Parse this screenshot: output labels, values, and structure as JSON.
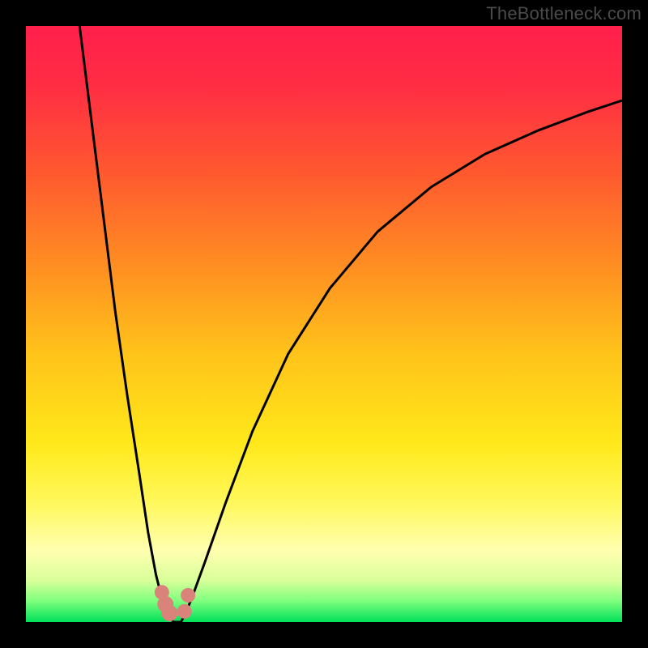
{
  "watermark": "TheBottleneck.com",
  "chart_data": {
    "type": "line",
    "title": "",
    "xlabel": "",
    "ylabel": "",
    "xlim": [
      0,
      1
    ],
    "ylim": [
      0,
      100
    ],
    "gradient_stops": [
      {
        "offset": 0.0,
        "color": "#ff1f4b"
      },
      {
        "offset": 0.1,
        "color": "#ff2d44"
      },
      {
        "offset": 0.25,
        "color": "#ff5a2f"
      },
      {
        "offset": 0.4,
        "color": "#ff8d22"
      },
      {
        "offset": 0.55,
        "color": "#ffc31a"
      },
      {
        "offset": 0.7,
        "color": "#ffe81a"
      },
      {
        "offset": 0.8,
        "color": "#fff85c"
      },
      {
        "offset": 0.88,
        "color": "#ffffb0"
      },
      {
        "offset": 0.93,
        "color": "#d9ff9a"
      },
      {
        "offset": 0.965,
        "color": "#7dff7d"
      },
      {
        "offset": 1.0,
        "color": "#00e05a"
      }
    ],
    "series": [
      {
        "name": "left-branch",
        "x": [
          0.09,
          0.11,
          0.13,
          0.15,
          0.17,
          0.19,
          0.205,
          0.218,
          0.228,
          0.236,
          0.242,
          0.248
        ],
        "y": [
          100.0,
          84.0,
          68.0,
          52.0,
          38.0,
          25.0,
          15.0,
          8.0,
          4.0,
          1.8,
          0.6,
          0.0
        ]
      },
      {
        "name": "right-branch",
        "x": [
          0.26,
          0.268,
          0.28,
          0.3,
          0.335,
          0.38,
          0.44,
          0.51,
          0.59,
          0.68,
          0.77,
          0.86,
          0.94,
          1.0
        ],
        "y": [
          0.0,
          1.5,
          4.5,
          10.0,
          20.0,
          32.0,
          45.0,
          56.0,
          65.5,
          73.0,
          78.5,
          82.5,
          85.5,
          87.5
        ]
      }
    ],
    "baseline": {
      "x": [
        0.248,
        0.26
      ],
      "y": [
        0.0,
        0.0
      ]
    },
    "markers": [
      {
        "x": 0.228,
        "y": 5.0,
        "r": 9
      },
      {
        "x": 0.234,
        "y": 3.0,
        "r": 10
      },
      {
        "x": 0.241,
        "y": 1.5,
        "r": 10
      },
      {
        "x": 0.266,
        "y": 1.8,
        "r": 9
      },
      {
        "x": 0.272,
        "y": 4.5,
        "r": 9
      }
    ],
    "marker_color": "#d9837b",
    "curve_color": "#000000",
    "curve_width": 3.0
  }
}
